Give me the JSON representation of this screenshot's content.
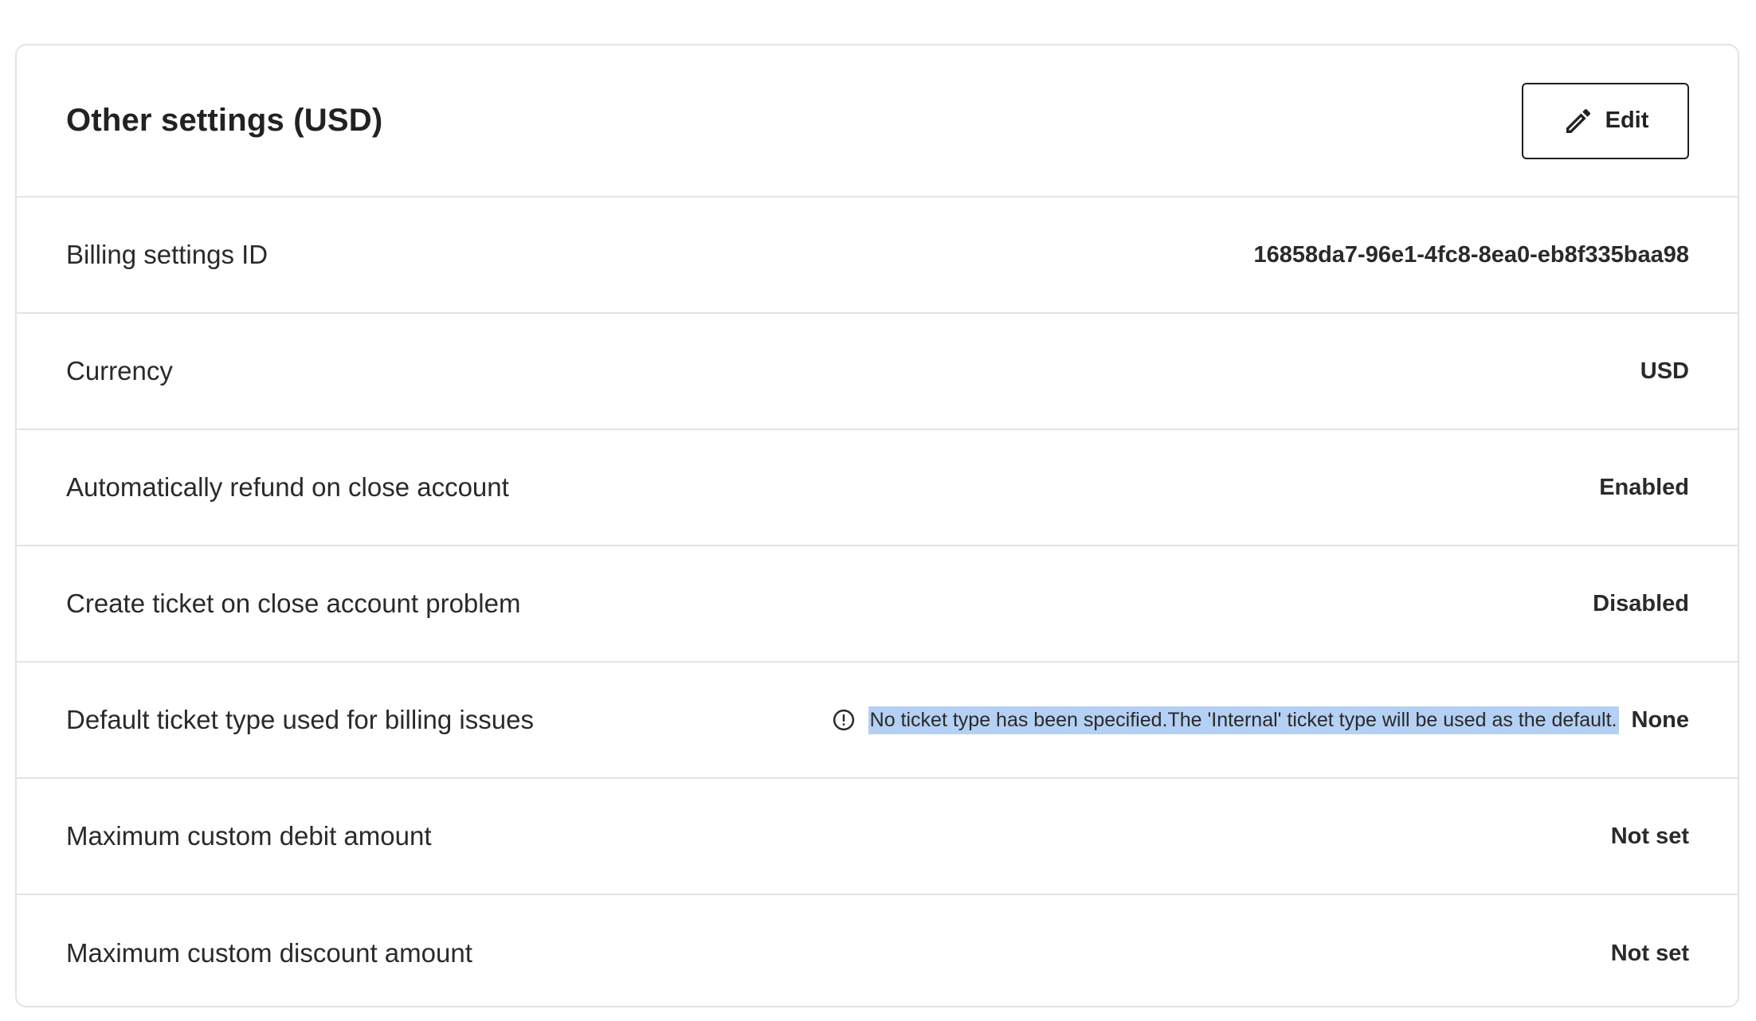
{
  "card": {
    "title": "Other settings (USD)",
    "edit_label": "Edit"
  },
  "rows": [
    {
      "label": "Billing settings ID",
      "value": "16858da7-96e1-4fc8-8ea0-eb8f335baa98"
    },
    {
      "label": "Currency",
      "value": "USD"
    },
    {
      "label": "Automatically refund on close account",
      "value": "Enabled"
    },
    {
      "label": "Create ticket on close account problem",
      "value": "Disabled"
    },
    {
      "label": "Default ticket type used for billing issues",
      "value": "None",
      "info_icon": "info-circle-icon",
      "info_text": "No ticket type has been specified.The 'Internal' ticket type will be used as the default."
    },
    {
      "label": "Maximum custom debit amount",
      "value": "Not set"
    },
    {
      "label": "Maximum custom discount amount",
      "value": "Not set"
    }
  ],
  "icons": {
    "edit": "pencil-icon",
    "info": "info-circle-icon"
  },
  "colors": {
    "border": "#e3e3e3",
    "text": "#2a2a2a",
    "selection_highlight": "#b4d0f4"
  }
}
